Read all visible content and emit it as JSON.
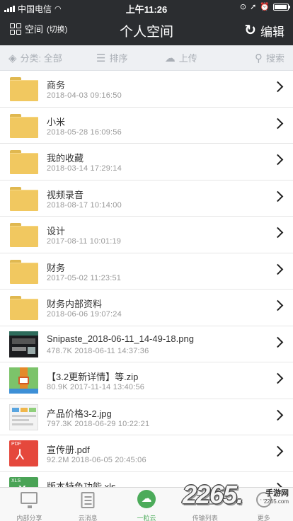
{
  "status_bar": {
    "carrier": "中国电信",
    "time": "上午11:26",
    "battery_level": 0.92
  },
  "nav": {
    "space_label": "空间",
    "space_switch": "(切换)",
    "title": "个人空间",
    "refresh_icon": "refresh-icon",
    "edit_label": "编辑"
  },
  "toolbar": {
    "category_label": "分类: 全部",
    "sort_label": "排序",
    "upload_label": "上传",
    "search_label": "搜索"
  },
  "files": [
    {
      "name": "商务",
      "meta": "2018-04-03 09:16:50",
      "kind": "folder"
    },
    {
      "name": "小米",
      "meta": "2018-05-28 16:09:56",
      "kind": "folder"
    },
    {
      "name": "我的收藏",
      "meta": "2018-03-14 17:29:14",
      "kind": "folder"
    },
    {
      "name": "视频录音",
      "meta": "2018-08-17 10:14:00",
      "kind": "folder"
    },
    {
      "name": "设计",
      "meta": "2017-08-11 10:01:19",
      "kind": "folder"
    },
    {
      "name": "财务",
      "meta": "2017-05-02 11:23:51",
      "kind": "folder"
    },
    {
      "name": "财务内部资料",
      "meta": "2018-06-06 19:07:24",
      "kind": "folder"
    },
    {
      "name": "Snipaste_2018-06-11_14-49-18.png",
      "meta": "478.7K  2018-06-11 14:37:36",
      "kind": "png"
    },
    {
      "name": "【3.2更新详情】等.zip",
      "meta": "80.9K  2017-11-14 13:40:56",
      "kind": "zip"
    },
    {
      "name": "产品价格3-2.jpg",
      "meta": "797.3K  2018-06-29 10:22:21",
      "kind": "jpg"
    },
    {
      "name": "宣传册.pdf",
      "meta": "92.2M  2018-06-05 20:45:06",
      "kind": "pdf",
      "badge": "PDF"
    },
    {
      "name": "版本特色功能.xls",
      "meta": "",
      "kind": "xls",
      "badge": "XLS"
    }
  ],
  "tabbar": {
    "items": [
      {
        "label": "内部分享",
        "icon": "monitor-icon",
        "active": false
      },
      {
        "label": "云消息",
        "icon": "document-icon",
        "active": false
      },
      {
        "label": "一粒云",
        "icon": "cloud-icon",
        "active": true
      },
      {
        "label": "传输列表",
        "icon": "list-icon",
        "active": false
      },
      {
        "label": "更多",
        "icon": "more-icon",
        "active": false
      }
    ],
    "active_color": "#4cab5a"
  },
  "watermark": {
    "number": "2265",
    "dot": ".",
    "text": "手游网",
    "url": "2265.com"
  }
}
